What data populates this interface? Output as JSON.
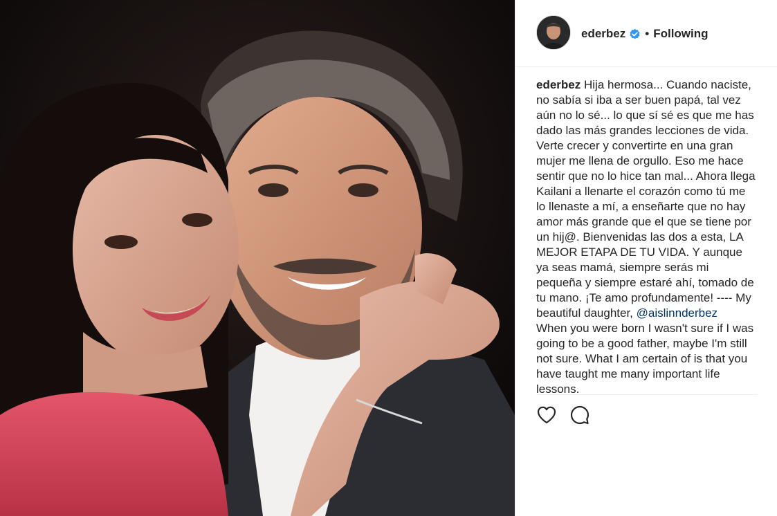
{
  "post": {
    "username": "ederbez",
    "separator": "•",
    "follow_status": "Following",
    "verified": true,
    "caption_user": "ederbez",
    "caption_part1": "Hija hermosa... Cuando naciste, no sabía si iba a ser buen papá, tal vez aún no lo sé... lo que sí sé es que me has dado las más grandes lecciones de vida.\nVerte crecer y convertirte en una gran mujer me llena de orgullo. Eso me hace sentir que no lo hice tan mal... Ahora llega Kailani a llenarte el corazón como tú me lo llenaste a mí, a enseñarte que no hay amor más grande que el que se tiene por un hij@. Bienvenidas las dos a esta, LA MEJOR ETAPA DE TU VIDA. Y aunque ya seas mamá, siempre serás mi pequeña y siempre estaré ahí, tomado de tu mano. ¡Te amo profundamente! ---- My beautiful daughter, ",
    "mention": "@aislinnderbez",
    "caption_part2": "When you were born I wasn't sure if I was going to be a good father, maybe I'm still not sure. What I am certain of is that you have taught me many important life lessons."
  },
  "icons": {
    "verified": "verified-badge-icon",
    "like": "heart-icon",
    "comment": "comment-bubble-icon"
  },
  "colors": {
    "text": "#262626",
    "mention": "#003569",
    "verified": "#3897f0",
    "border": "#efefef"
  }
}
